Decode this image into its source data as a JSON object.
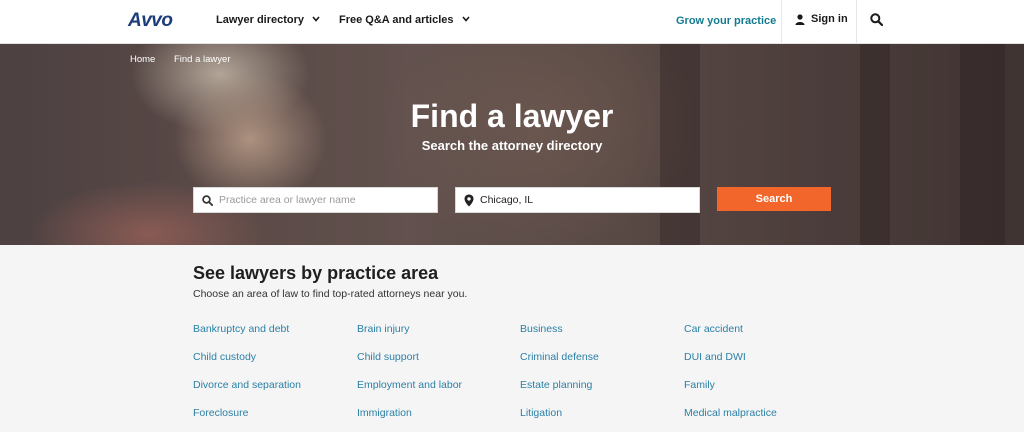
{
  "header": {
    "logo": "Avvo",
    "nav": [
      {
        "label": "Lawyer directory"
      },
      {
        "label": "Free Q&A and articles"
      }
    ],
    "grow": "Grow your practice",
    "signin": "Sign in",
    "icons": {
      "chevron": "chevron-down-icon",
      "user": "user-icon",
      "search": "search-icon"
    }
  },
  "hero": {
    "breadcrumb": [
      "Home",
      "Find a lawyer"
    ],
    "title": "Find a lawyer",
    "subtitle": "Search the attorney directory",
    "practice_placeholder": "Practice area or lawyer name",
    "location_value": "Chicago, IL",
    "search_label": "Search",
    "colors": {
      "button": "#f2652b"
    }
  },
  "practice": {
    "title": "See lawyers by practice area",
    "subtitle": "Choose an area of law to find top-rated attorneys near you.",
    "areas": [
      "Bankruptcy and debt",
      "Brain injury",
      "Business",
      "Car accident",
      "Child custody",
      "Child support",
      "Criminal defense",
      "DUI and DWI",
      "Divorce and separation",
      "Employment and labor",
      "Estate planning",
      "Family",
      "Foreclosure",
      "Immigration",
      "Litigation",
      "Medical malpractice"
    ],
    "link_color": "#2a80a6"
  }
}
